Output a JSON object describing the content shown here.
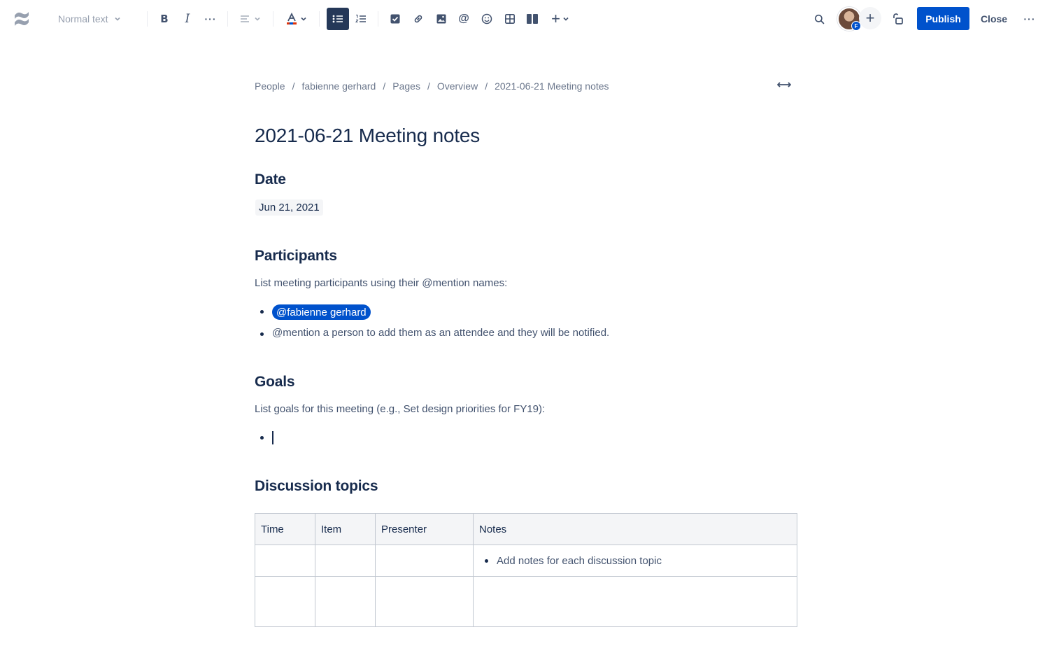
{
  "toolbar": {
    "logo_icon": "confluence-logo-icon",
    "text_style": "Normal text",
    "bold_label": "B",
    "italic_label": "I",
    "more_formatting": "···",
    "mention_label": "@",
    "insert_label": "+",
    "more_label": "···",
    "publish_label": "Publish",
    "close_label": "Close",
    "avatar_initial": "F",
    "invite_label": "+",
    "active_tool": "bullet-list",
    "accent_color": "#0052cc",
    "active_tool_color": "#253858"
  },
  "breadcrumb": {
    "items": [
      "People",
      "fabienne gerhard",
      "Pages",
      "Overview",
      "2021-06-21 Meeting notes"
    ],
    "separator": "/"
  },
  "page": {
    "title": "2021-06-21 Meeting notes",
    "date_heading": "Date",
    "date_value": "Jun 21, 2021",
    "participants_heading": "Participants",
    "participants_instructions": "List meeting participants using their @mention names:",
    "participants": {
      "mention": "@fabienne gerhard",
      "hint": "@mention a person to add them as an attendee and they will be notified."
    },
    "goals_heading": "Goals",
    "goals_instructions": "List goals for this meeting (e.g., Set design priorities for FY19):",
    "discussion_heading": "Discussion topics",
    "table": {
      "headers": [
        "Time",
        "Item",
        "Presenter",
        "Notes"
      ],
      "rows": [
        [
          "",
          "",
          "",
          "Add notes for each discussion topic"
        ],
        [
          "",
          "",
          "",
          ""
        ]
      ]
    }
  }
}
